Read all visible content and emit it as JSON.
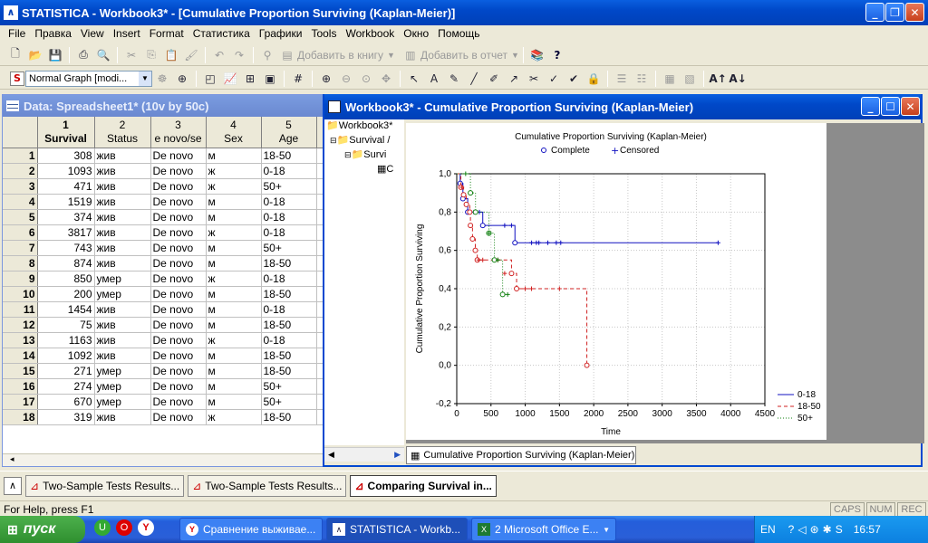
{
  "app": {
    "title": "STATISTICA - Workbook3* - [Cumulative Proportion Surviving (Kaplan-Meier)]",
    "icon": "statistica-logo-icon"
  },
  "menu": [
    "File",
    "Правка",
    "View",
    "Insert",
    "Format",
    "Статистика",
    "Графики",
    "Tools",
    "Workbook",
    "Окно",
    "Помощь"
  ],
  "toolbar1": {
    "add_to_book": "Добавить в книгу",
    "add_to_report": "Добавить в отчет"
  },
  "toolbar2": {
    "graph_style": "Normal Graph [modi..."
  },
  "spreadsheet": {
    "title": "Data: Spreadsheet1* (10v by 50c)",
    "columns": [
      {
        "num": "1",
        "name": "Survival",
        "bold": true
      },
      {
        "num": "2",
        "name": "Status"
      },
      {
        "num": "3",
        "name": "e novo/se"
      },
      {
        "num": "4",
        "name": "Sex"
      },
      {
        "num": "5",
        "name": "Age"
      }
    ],
    "rows": [
      [
        "1",
        "308",
        "жив",
        "De novo",
        "м",
        "18-50"
      ],
      [
        "2",
        "1093",
        "жив",
        "De novo",
        "ж",
        "0-18"
      ],
      [
        "3",
        "471",
        "жив",
        "De novo",
        "ж",
        "50+"
      ],
      [
        "4",
        "1519",
        "жив",
        "De novo",
        "м",
        "0-18"
      ],
      [
        "5",
        "374",
        "жив",
        "De novo",
        "м",
        "0-18"
      ],
      [
        "6",
        "3817",
        "жив",
        "De novo",
        "ж",
        "0-18"
      ],
      [
        "7",
        "743",
        "жив",
        "De novo",
        "м",
        "50+"
      ],
      [
        "8",
        "874",
        "жив",
        "De novo",
        "м",
        "18-50"
      ],
      [
        "9",
        "850",
        "умер",
        "De novo",
        "ж",
        "0-18"
      ],
      [
        "10",
        "200",
        "умер",
        "De novo",
        "м",
        "18-50"
      ],
      [
        "11",
        "1454",
        "жив",
        "De novo",
        "м",
        "0-18"
      ],
      [
        "12",
        "75",
        "жив",
        "De novo",
        "м",
        "18-50"
      ],
      [
        "13",
        "1163",
        "жив",
        "De novo",
        "ж",
        "0-18"
      ],
      [
        "14",
        "1092",
        "жив",
        "De novo",
        "м",
        "18-50"
      ],
      [
        "15",
        "271",
        "умер",
        "De novo",
        "м",
        "18-50"
      ],
      [
        "16",
        "274",
        "умер",
        "De novo",
        "м",
        "50+"
      ],
      [
        "17",
        "670",
        "умер",
        "De novo",
        "м",
        "50+"
      ],
      [
        "18",
        "319",
        "жив",
        "De novo",
        "ж",
        "18-50"
      ]
    ]
  },
  "workbook": {
    "title": "Workbook3* - Cumulative Proportion Surviving (Kaplan-Meier)",
    "tree": [
      "Workbook3*",
      "Survival /",
      "Survi",
      "C"
    ],
    "tab": "Cumulative Proportion Surviving (Kaplan-Meier)"
  },
  "chart_data": {
    "type": "line",
    "title": "Cumulative Proportion Surviving (Kaplan-Meier)",
    "xlabel": "Time",
    "ylabel": "Cumulative Proportion Surviving",
    "xlim": [
      0,
      4500
    ],
    "ylim": [
      -0.2,
      1.0
    ],
    "xticks": [
      "0",
      "500",
      "1000",
      "1500",
      "2000",
      "2500",
      "3000",
      "3500",
      "4000",
      "4500"
    ],
    "yticks": [
      "-0,2",
      "0,0",
      "0,2",
      "0,4",
      "0,6",
      "0,8",
      "1,0"
    ],
    "grid": true,
    "marker_legend": [
      {
        "label": "Complete",
        "symbol": "circle"
      },
      {
        "label": "Censored",
        "symbol": "plus"
      }
    ],
    "series": [
      {
        "name": "0-18",
        "color": "#1010c0",
        "dash": "",
        "steps": [
          [
            0,
            1.0
          ],
          [
            50,
            0.95
          ],
          [
            90,
            0.87
          ],
          [
            160,
            0.8
          ],
          [
            380,
            0.73
          ],
          [
            850,
            0.64
          ],
          [
            3817,
            0.64
          ]
        ],
        "complete": [
          [
            50,
            0.95
          ],
          [
            90,
            0.87
          ],
          [
            160,
            0.8
          ],
          [
            380,
            0.73
          ],
          [
            850,
            0.64
          ]
        ],
        "censored": [
          [
            250,
            0.8
          ],
          [
            330,
            0.8
          ],
          [
            700,
            0.73
          ],
          [
            800,
            0.73
          ],
          [
            1093,
            0.64
          ],
          [
            1163,
            0.64
          ],
          [
            1200,
            0.64
          ],
          [
            1330,
            0.64
          ],
          [
            1454,
            0.64
          ],
          [
            1519,
            0.64
          ],
          [
            3817,
            0.64
          ]
        ]
      },
      {
        "name": "18-50",
        "color": "#d02020",
        "dash": "4,3",
        "steps": [
          [
            0,
            1.0
          ],
          [
            60,
            0.93
          ],
          [
            100,
            0.89
          ],
          [
            140,
            0.84
          ],
          [
            190,
            0.8
          ],
          [
            200,
            0.73
          ],
          [
            230,
            0.66
          ],
          [
            271,
            0.6
          ],
          [
            300,
            0.55
          ],
          [
            800,
            0.48
          ],
          [
            874,
            0.4
          ],
          [
            1900,
            0.0
          ]
        ],
        "complete": [
          [
            60,
            0.93
          ],
          [
            100,
            0.89
          ],
          [
            140,
            0.84
          ],
          [
            190,
            0.8
          ],
          [
            200,
            0.73
          ],
          [
            230,
            0.66
          ],
          [
            271,
            0.6
          ],
          [
            300,
            0.55
          ],
          [
            800,
            0.48
          ],
          [
            874,
            0.4
          ],
          [
            1900,
            0.0
          ]
        ],
        "censored": [
          [
            75,
            0.93
          ],
          [
            319,
            0.55
          ],
          [
            380,
            0.55
          ],
          [
            600,
            0.55
          ],
          [
            700,
            0.48
          ],
          [
            1000,
            0.4
          ],
          [
            1092,
            0.4
          ],
          [
            1500,
            0.4
          ]
        ]
      },
      {
        "name": "50+",
        "color": "#108010",
        "dash": "1,2",
        "steps": [
          [
            0,
            1.0
          ],
          [
            200,
            0.9
          ],
          [
            274,
            0.8
          ],
          [
            470,
            0.69
          ],
          [
            550,
            0.55
          ],
          [
            670,
            0.37
          ],
          [
            743,
            0.37
          ]
        ],
        "complete": [
          [
            200,
            0.9
          ],
          [
            274,
            0.8
          ],
          [
            470,
            0.69
          ],
          [
            550,
            0.55
          ],
          [
            670,
            0.37
          ]
        ],
        "censored": [
          [
            130,
            1.0
          ],
          [
            471,
            0.69
          ],
          [
            600,
            0.55
          ],
          [
            743,
            0.37
          ]
        ]
      }
    ]
  },
  "taskbar_windows": [
    "Two-Sample Tests Results...",
    "Two-Sample Tests Results...",
    "Comparing Survival in..."
  ],
  "statusbar": {
    "help": "For Help, press F1",
    "caps": "CAPS",
    "num": "NUM",
    "rec": "REC"
  },
  "os_taskbar": {
    "start": "пуск",
    "items": [
      "Сравнение выживае...",
      "STATISTICA - Workb...",
      "2 Microsoft Office E..."
    ],
    "lang": "EN",
    "time": "16:57"
  }
}
